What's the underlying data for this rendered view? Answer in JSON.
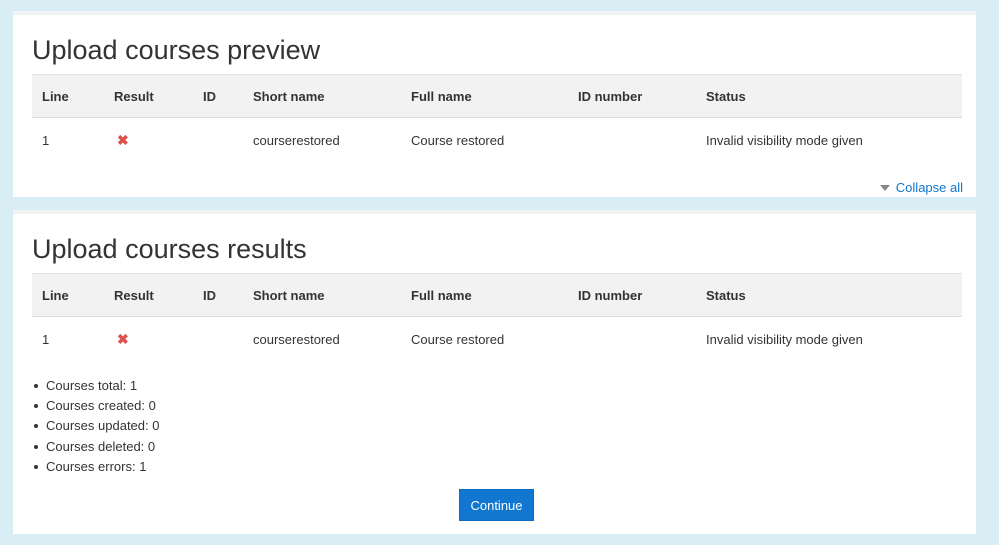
{
  "preview": {
    "title": "Upload courses preview",
    "columns": [
      "Line",
      "Result",
      "ID",
      "Short name",
      "Full name",
      "ID number",
      "Status"
    ],
    "rows": [
      {
        "line": "1",
        "result_icon": "error-x-icon",
        "id": "",
        "short_name": "courserestored",
        "full_name": "Course restored",
        "id_number": "",
        "status": "Invalid visibility mode given"
      }
    ],
    "collapse_label": "Collapse all"
  },
  "results": {
    "title": "Upload courses results",
    "columns": [
      "Line",
      "Result",
      "ID",
      "Short name",
      "Full name",
      "ID number",
      "Status"
    ],
    "rows": [
      {
        "line": "1",
        "result_icon": "error-x-icon",
        "id": "",
        "short_name": "courserestored",
        "full_name": "Course restored",
        "id_number": "",
        "status": "Invalid visibility mode given"
      }
    ],
    "summary": [
      "Courses total: 1",
      "Courses created: 0",
      "Courses updated: 0",
      "Courses deleted: 0",
      "Courses errors: 1"
    ],
    "continue_label": "Continue"
  },
  "colors": {
    "background": "#d9edf4",
    "accent": "#1177d1",
    "error": "#d9534f"
  }
}
